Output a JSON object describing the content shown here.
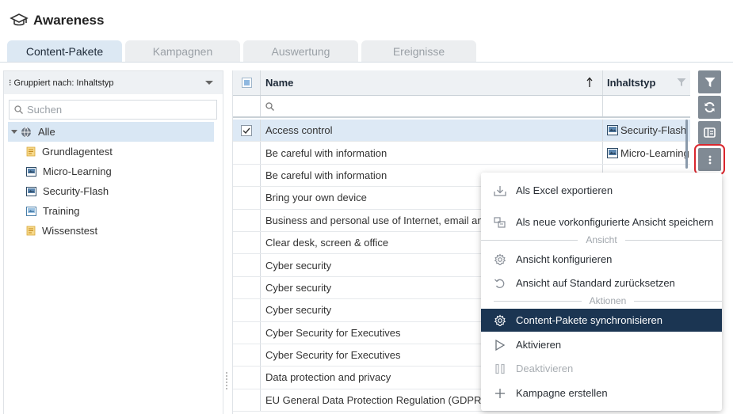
{
  "app": {
    "title": "Awareness",
    "icon": "graduation-cap-icon"
  },
  "tabs": [
    {
      "label": "Content-Pakete",
      "active": true
    },
    {
      "label": "Kampagnen",
      "active": false
    },
    {
      "label": "Auswertung",
      "active": false
    },
    {
      "label": "Ereignisse",
      "active": false
    }
  ],
  "sidebar": {
    "group_by": "⁝ Gruppiert nach: Inhaltstyp",
    "search_placeholder": "Suchen",
    "root": {
      "label": "Alle",
      "icon": "globe-icon"
    },
    "items": [
      {
        "label": "Grundlagentest",
        "icon": "test-icon"
      },
      {
        "label": "Micro-Learning",
        "icon": "media-icon"
      },
      {
        "label": "Security-Flash",
        "icon": "media-icon"
      },
      {
        "label": "Training",
        "icon": "training-icon"
      },
      {
        "label": "Wissenstest",
        "icon": "test-icon"
      }
    ]
  },
  "grid": {
    "columns": {
      "name": "Name",
      "type": "Inhaltstyp"
    },
    "rows": [
      {
        "name": "Access control",
        "type": "Security-Flash",
        "selected": true
      },
      {
        "name": "Be careful with information",
        "type": "Micro-Learning",
        "selected": false
      },
      {
        "name": "Be careful with information",
        "type": "",
        "selected": false
      },
      {
        "name": "Bring your own device",
        "type": "",
        "selected": false
      },
      {
        "name": "Business and personal use of Internet, email and s",
        "type": "",
        "selected": false
      },
      {
        "name": "Clear desk, screen & office",
        "type": "",
        "selected": false
      },
      {
        "name": "Cyber security",
        "type": "",
        "selected": false
      },
      {
        "name": "Cyber security",
        "type": "",
        "selected": false
      },
      {
        "name": "Cyber security",
        "type": "",
        "selected": false
      },
      {
        "name": "Cyber Security for Executives",
        "type": "",
        "selected": false
      },
      {
        "name": "Cyber Security for Executives",
        "type": "",
        "selected": false
      },
      {
        "name": "Data protection and privacy",
        "type": "",
        "selected": false
      },
      {
        "name": "EU General Data Protection Regulation (GDPR)",
        "type": "",
        "selected": false
      }
    ]
  },
  "toolbar": {
    "buttons": [
      "filter-icon",
      "refresh-icon",
      "layout-icon",
      "more-icon"
    ]
  },
  "context_menu": {
    "export_excel": "Als Excel exportieren",
    "save_view": "Als neue vorkonfigurierte Ansicht speichern",
    "section_view": "Ansicht",
    "configure_view": "Ansicht konfigurieren",
    "reset_view": "Ansicht auf Standard zurücksetzen",
    "section_actions": "Aktionen",
    "sync_packages": "Content-Pakete synchronisieren",
    "activate": "Aktivieren",
    "deactivate": "Deaktivieren",
    "create_campaign": "Kampagne erstellen"
  },
  "colors": {
    "accent_dark": "#1b3552",
    "selection": "#d9e7f4",
    "highlight_border": "#d9262d",
    "toolbar_button": "#808a94"
  }
}
